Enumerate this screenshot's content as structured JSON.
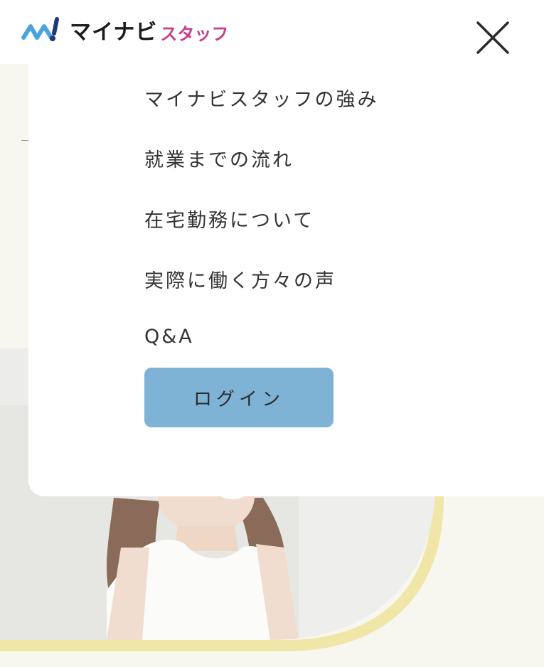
{
  "header": {
    "logo_main": "マイナビ",
    "logo_sub": "スタッフ",
    "close_icon": "close-icon"
  },
  "menu": {
    "items": [
      {
        "label": "マイナビスタッフの強み"
      },
      {
        "label": "就業までの流れ"
      },
      {
        "label": "在宅勤務について"
      },
      {
        "label": "実際に働く方々の声"
      },
      {
        "label": "Q&A"
      }
    ],
    "login_label": "ログイン"
  },
  "colors": {
    "brand_blue": "#2f8fd1",
    "brand_pink": "#c93e8a",
    "login_button": "#7fb3d6",
    "accent_yellow": "#efe6a8",
    "background": "#f8f7ef"
  }
}
